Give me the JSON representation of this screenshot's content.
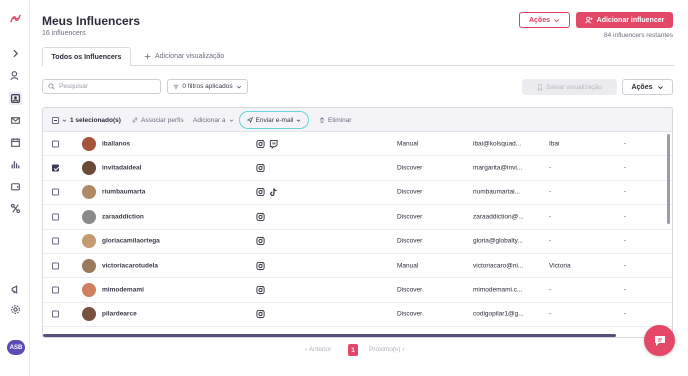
{
  "header": {
    "title": "Meus Influencers",
    "subtitle": "16 influencers",
    "actions_label": "Ações",
    "add_label": "Adicionar influencer",
    "remaining": "84 influencers restantes"
  },
  "tabs": {
    "active": "Todos os Influencers",
    "add_view": "Adicionar visualização"
  },
  "filters": {
    "search_placeholder": "Pesquisar",
    "filters_applied": "0 filtros aplicados",
    "save_view": "Salvar visualização",
    "actions_label": "Ações"
  },
  "toolbar": {
    "selected": "1 selecionado(s)",
    "associate": "Associar perfis",
    "add_to": "Adicionar a",
    "send_email": "Enviar e-mail",
    "delete": "Eliminar"
  },
  "rows": [
    {
      "username": "iballanos",
      "networks": [
        "instagram",
        "twitch"
      ],
      "origin": "Manual",
      "email": "ibai@kolsquad...",
      "c5": "Ibai",
      "c6": "-",
      "checked": false,
      "avatar_color": "#a4553a"
    },
    {
      "username": "invitadaideal",
      "networks": [
        "instagram"
      ],
      "origin": "Discover",
      "email": "margarita@invi...",
      "c5": "-",
      "c6": "-",
      "checked": true,
      "avatar_color": "#6b4a36"
    },
    {
      "username": "riumbaumarta",
      "networks": [
        "instagram",
        "tiktok"
      ],
      "origin": "Discover",
      "email": "riumbaumartai...",
      "c5": "-",
      "c6": "-",
      "checked": false,
      "avatar_color": "#b08a66"
    },
    {
      "username": "zaraaddiction",
      "networks": [
        "instagram"
      ],
      "origin": "Discover",
      "email": "zaraaddiction@...",
      "c5": "-",
      "c6": "-",
      "checked": false,
      "avatar_color": "#8a8a8a"
    },
    {
      "username": "gloriacamilaortega",
      "networks": [
        "instagram"
      ],
      "origin": "Discover",
      "email": "gloria@globalty...",
      "c5": "-",
      "c6": "-",
      "checked": false,
      "avatar_color": "#c49a72"
    },
    {
      "username": "victoriacarotudela",
      "networks": [
        "instagram"
      ],
      "origin": "Manual",
      "email": "victoriacaro@ni...",
      "c5": "Victoria",
      "c6": "-",
      "checked": false,
      "avatar_color": "#9a7a5a"
    },
    {
      "username": "mimodemami",
      "networks": [
        "instagram"
      ],
      "origin": "Discover",
      "email": "mimodemami.c...",
      "c5": "-",
      "c6": "-",
      "checked": false,
      "avatar_color": "#d08060"
    },
    {
      "username": "pilardearce",
      "networks": [
        "instagram"
      ],
      "origin": "Discover",
      "email": "codigopilar1@g...",
      "c5": "-",
      "c6": "-",
      "checked": false,
      "avatar_color": "#7a5040"
    }
  ],
  "pagination": {
    "prev": "‹ Anterior",
    "page": "1",
    "next": "Próximo(s) ›"
  },
  "user": {
    "initials": "ASB"
  },
  "colors": {
    "accent": "#e34866",
    "highlight": "#6ad4d8",
    "nav_dark": "#5c4bb4"
  }
}
